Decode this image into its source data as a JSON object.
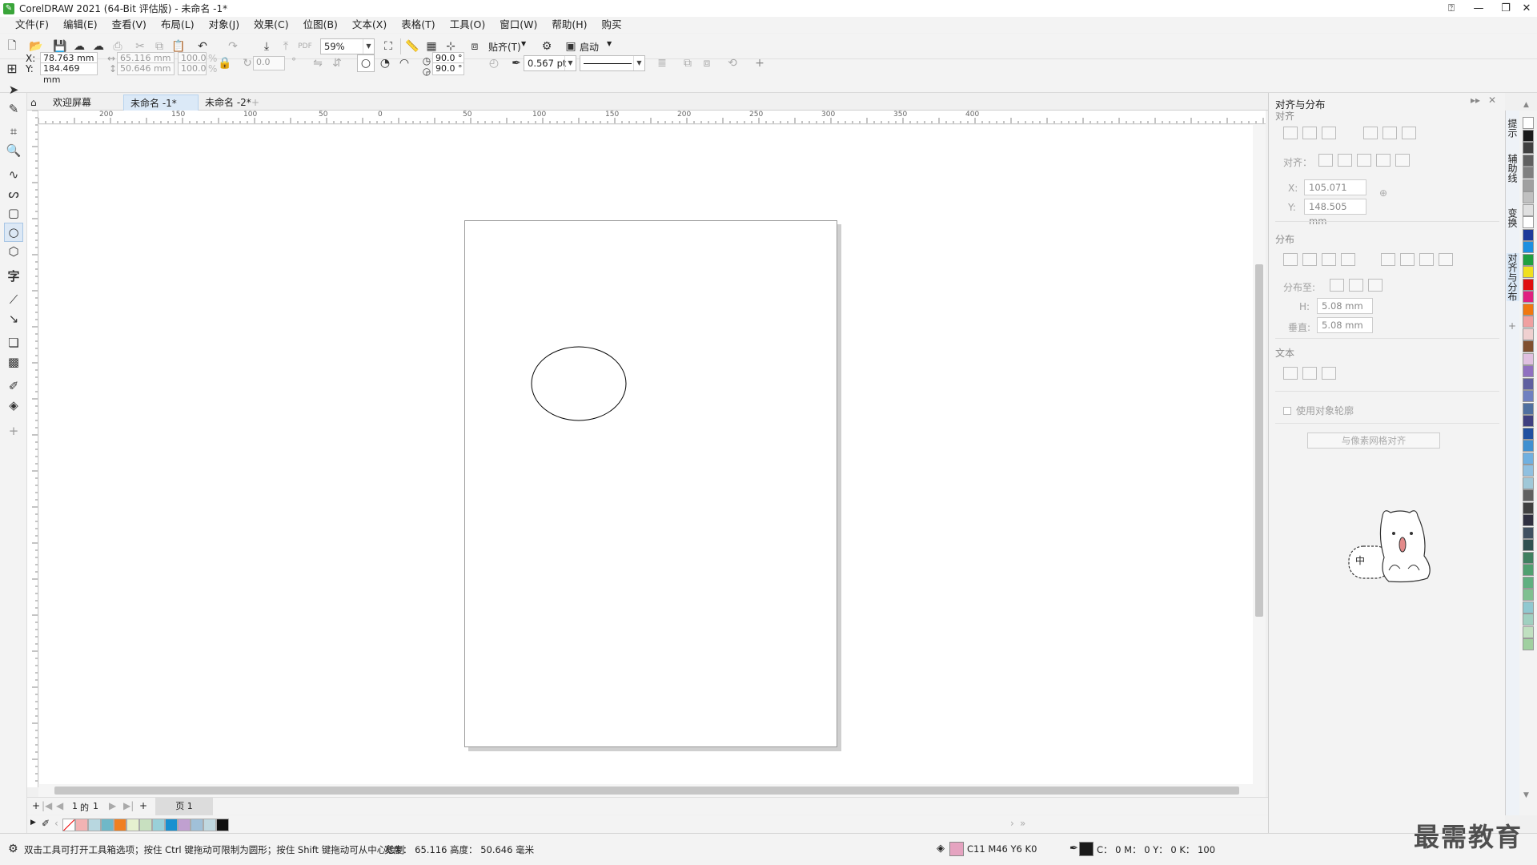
{
  "title": "CorelDRAW 2021 (64-Bit 评估版) - 未命名 -1*",
  "menu": [
    "文件(F)",
    "编辑(E)",
    "查看(V)",
    "布局(L)",
    "对象(J)",
    "效果(C)",
    "位图(B)",
    "文本(X)",
    "表格(T)",
    "工具(O)",
    "窗口(W)",
    "帮助(H)",
    "购买"
  ],
  "toolbar": {
    "zoom": "59%",
    "snap_label": "贴齐(T)",
    "launch_label": "启动"
  },
  "propbar": {
    "x_label": "X:",
    "x_value": "78.763 mm",
    "y_label": "Y:",
    "y_value": "184.469 mm",
    "w_value": "65.116 mm",
    "h_value": "50.646 mm",
    "sx": "100.0",
    "sy": "100.0",
    "pct": "%",
    "rotation": "0.0",
    "deg": "°",
    "start_angle": "90.0 °",
    "end_angle": "90.0 °",
    "outline_width": "0.567 pt"
  },
  "tabs": [
    "欢迎屏幕",
    "未命名 -1*",
    "未命名 -2*"
  ],
  "ruler_h": [
    "200",
    "150",
    "100",
    "50",
    "0",
    "50",
    "100",
    "150",
    "200",
    "250",
    "300",
    "350",
    "400"
  ],
  "ruler_unit": "毫米",
  "pagenav": {
    "current": "1",
    "of": "的",
    "total": "1",
    "page_tab": "页 1"
  },
  "status": {
    "hint": "双击工具可打开工具箱选项；按住 Ctrl 键拖动可限制为圆形；按住 Shift 键拖动可从中心绘制",
    "size": "宽度： 65.116  高度： 50.646  毫米",
    "fill": "C11 M46 Y6 K0",
    "outline": "C： 0 M： 0 Y： 0 K： 100"
  },
  "docker": {
    "title": "对齐与分布",
    "align_section": "对齐",
    "align_to_label": "对齐：",
    "x_label": "X:",
    "x_value": "105.071 mm",
    "y_label": "Y:",
    "y_value": "148.505 mm",
    "distribute_section": "分布",
    "distribute_to_label": "分布至:",
    "h_label": "H:",
    "h_value": "5.08 mm",
    "v_label": "垂直:",
    "v_value": "5.08 mm",
    "text_section": "文本",
    "use_outline": "使用对象轮廓",
    "grid_button": "与像素网格对齐"
  },
  "side_tabs": [
    "提示",
    "辅助线",
    "变换",
    "对齐与分布"
  ],
  "mascot_text": "中",
  "watermark": "最需教育",
  "colors": {
    "accent": "#2a78c8",
    "fill_swatch": "#e5a3c0",
    "palette_bottom": [
      "#f2b3b3",
      "#b8d7e0",
      "#6fb8c8",
      "#f08020",
      "#e6f0d0",
      "#c8e0c0",
      "#99d0d8",
      "#1890d0",
      "#c0a0d0",
      "#a0c0d8",
      "#c0d8e0",
      "#101010"
    ],
    "palette_right": [
      "#ffffff",
      "#1a1a1a",
      "#404040",
      "#606060",
      "#808080",
      "#a0a0a0",
      "#c0c0c0",
      "#e0e0e0",
      "#ffffff",
      "#1e3a9a",
      "#1e90e0",
      "#20a040",
      "#f0e020",
      "#e01010",
      "#e02080",
      "#f07810",
      "#f0a0a0",
      "#f0d0d0",
      "#805030",
      "#e0c0e0",
      "#9070c0",
      "#6060a0",
      "#7080c0",
      "#5070a0",
      "#404080",
      "#2050a0",
      "#4090d0",
      "#70b0e0",
      "#90c0e0",
      "#a0c8d8",
      "#606060",
      "#404040",
      "#303040",
      "#405060",
      "#305050",
      "#408060",
      "#50a070",
      "#60b080",
      "#80c090",
      "#90c8d0",
      "#a0d0c0",
      "#c0e0c0",
      "#a0d0a0"
    ]
  }
}
